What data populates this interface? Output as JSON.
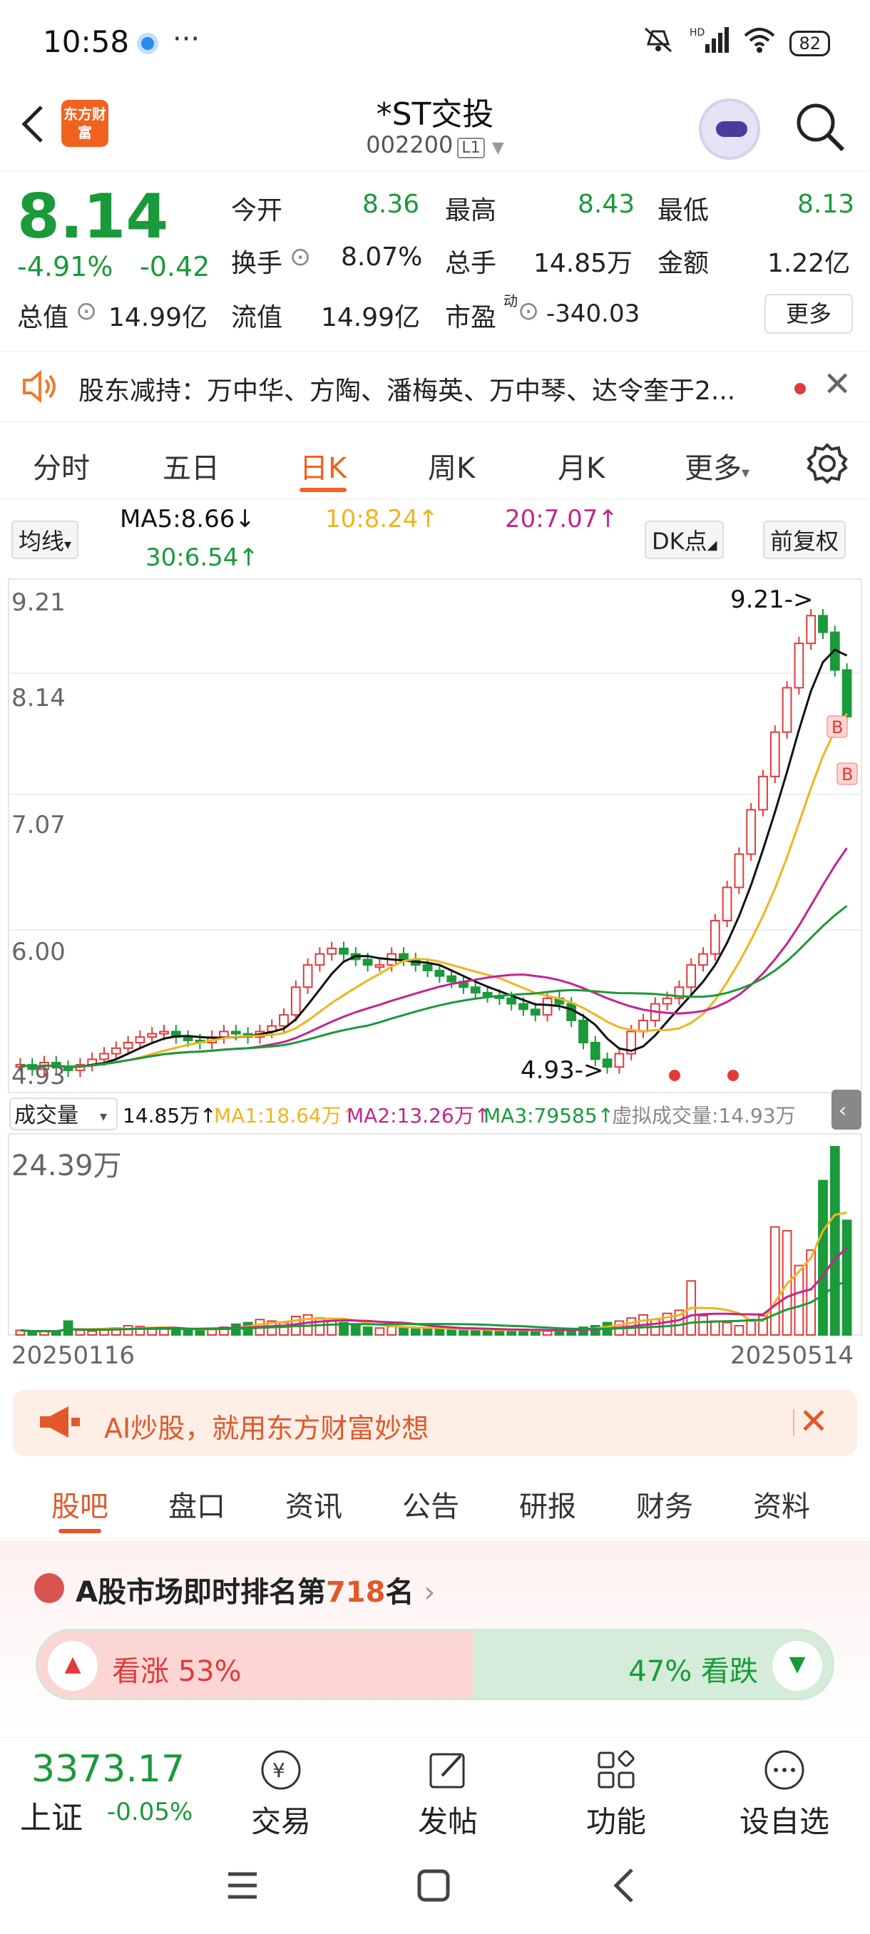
{
  "status_bar": {
    "time": "10:58",
    "more": "···",
    "battery": "82",
    "hd": "HD"
  },
  "header": {
    "back": "<",
    "logo": "东方财富",
    "title": "*ST交投",
    "code": "002200",
    "level": "L1"
  },
  "quote": {
    "price": "8.14",
    "pct": "-4.91%",
    "change": "-0.42",
    "open_label": "今开",
    "open": "8.36",
    "high_label": "最高",
    "high": "8.43",
    "low_label": "最低",
    "low": "8.13",
    "turnover_label": "换手",
    "turnover": "8.07%",
    "volume_label": "总手",
    "volume": "14.85万",
    "amount_label": "金额",
    "amount": "1.22亿",
    "mktcap_label": "总值",
    "mktcap": "14.99亿",
    "float_label": "流值",
    "float_cap": "14.99亿",
    "pe_label": "市盈",
    "pe_sup": "动",
    "pe": "-340.03",
    "more_label": "更多"
  },
  "notice": {
    "text": "股东减持：万中华、方陶、潘梅英、万中琴、达令奎于2..."
  },
  "tabs": [
    "分时",
    "五日",
    "日K",
    "周K",
    "月K",
    "更多"
  ],
  "active_tab": "日K",
  "ma_legend": {
    "selector": "均线",
    "ma5": "MA5:8.66↓",
    "ma10": "10:8.24↑",
    "ma20": "20:7.07↑",
    "ma30": "30:6.54↑",
    "dk": "DK点",
    "adjust": "前复权",
    "ma5_color": "#111111",
    "ma10_color": "#f0b41e",
    "ma20_color": "#c4258f",
    "ma30_color": "#1a9a3a"
  },
  "chart_data": {
    "type": "candlestick",
    "y_axis_labels": [
      "9.21",
      "8.14",
      "7.07",
      "6.00",
      "4.93"
    ],
    "high_annotation": "9.21->",
    "low_annotation": "4.93->",
    "start_date": "20250116",
    "end_date": "20250514",
    "closes": [
      5.0,
      4.96,
      5.02,
      4.98,
      4.95,
      5.0,
      5.05,
      5.1,
      5.15,
      5.2,
      5.25,
      5.28,
      5.3,
      5.25,
      5.22,
      5.2,
      5.25,
      5.3,
      5.28,
      5.25,
      5.3,
      5.35,
      5.45,
      5.7,
      5.9,
      6.0,
      6.05,
      6.0,
      5.95,
      5.9,
      5.9,
      6.0,
      5.95,
      5.9,
      5.85,
      5.8,
      5.75,
      5.7,
      5.65,
      5.62,
      5.6,
      5.55,
      5.5,
      5.45,
      5.6,
      5.55,
      5.4,
      5.2,
      5.05,
      4.98,
      5.1,
      5.3,
      5.4,
      5.55,
      5.6,
      5.7,
      5.9,
      6.0,
      6.3,
      6.6,
      6.9,
      7.3,
      7.6,
      8.0,
      8.4,
      8.8,
      9.05,
      8.9,
      8.56,
      8.14
    ],
    "volume_label": "成交量",
    "volume_value": "14.85万↑",
    "vol_ma1": "MA1:18.64万↑",
    "vol_ma2": "MA2:13.26万↑",
    "vol_ma3": "MA3:79585↑",
    "virtual_volume": "虚拟成交量:14.93万",
    "volume_max_label": "24.39万",
    "volumes": [
      0.6,
      0.4,
      0.5,
      0.4,
      1.8,
      0.6,
      0.5,
      0.7,
      0.9,
      1.2,
      1.1,
      0.8,
      0.9,
      0.7,
      0.6,
      0.7,
      0.8,
      1.0,
      1.4,
      1.6,
      2.0,
      1.8,
      1.6,
      2.4,
      2.6,
      2.2,
      1.8,
      1.6,
      1.2,
      1.0,
      0.9,
      1.1,
      1.0,
      0.8,
      0.9,
      0.7,
      0.6,
      0.7,
      0.8,
      0.6,
      0.5,
      0.6,
      0.7,
      0.6,
      0.5,
      0.7,
      0.8,
      1.0,
      1.2,
      1.6,
      1.8,
      2.2,
      2.6,
      2.0,
      2.8,
      3.2,
      7.0,
      2.5,
      1.8,
      1.6,
      1.2,
      2.0,
      2.5,
      14.0,
      13.5,
      9.0,
      11.0,
      20.0,
      24.39,
      14.85
    ]
  },
  "banner": {
    "text": "AI炒股，就用东方财富妙想"
  },
  "bottom_tabs": [
    "股吧",
    "盘口",
    "资讯",
    "公告",
    "研报",
    "财务",
    "资料"
  ],
  "ranking": {
    "prefix": "A股市场即时排名第",
    "number": "718",
    "suffix": "名",
    "up_label": "看涨 53%",
    "down_label": "47% 看跌",
    "up_pct": 53
  },
  "toolbar": {
    "index_value": "3373.17",
    "index_name": "上证",
    "index_pct": "-0.05%",
    "items": [
      "交易",
      "发帖",
      "功能",
      "设自选"
    ]
  }
}
